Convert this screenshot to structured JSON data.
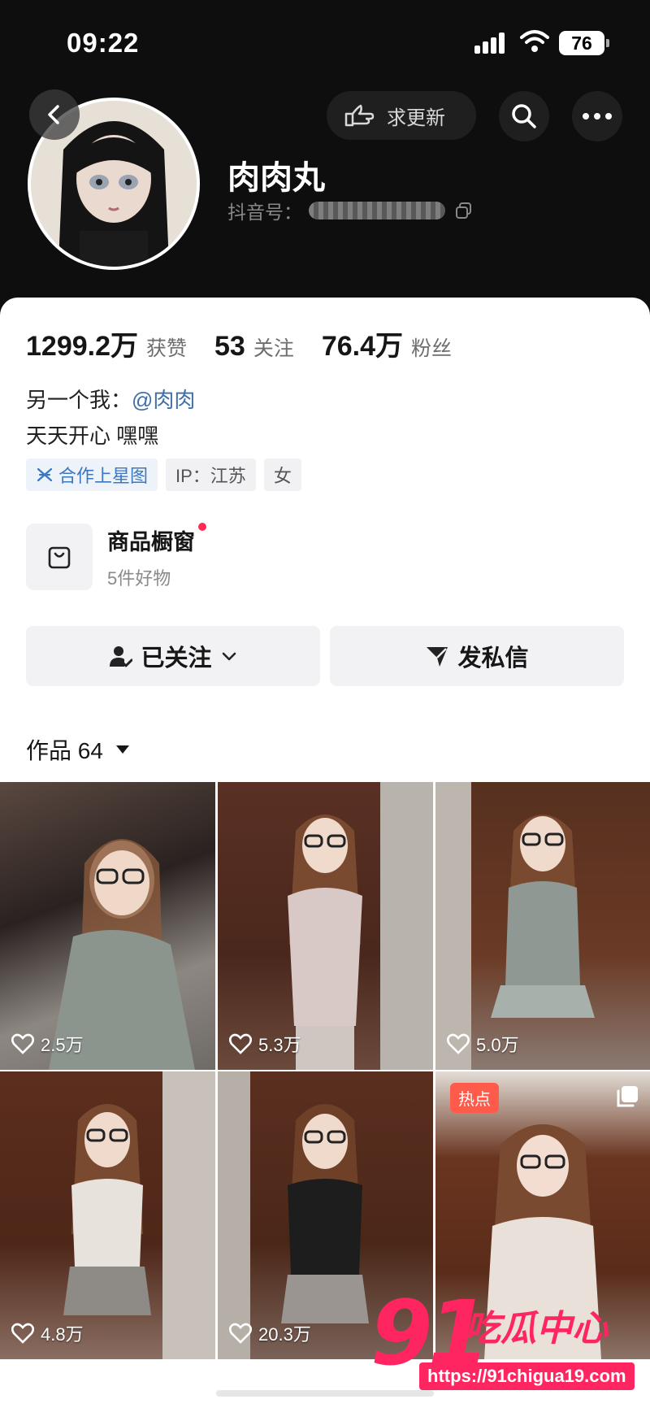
{
  "status_bar": {
    "time": "09:22",
    "battery": "76"
  },
  "top_actions": {
    "request_update_label": "求更新"
  },
  "profile": {
    "name": "肉肉丸",
    "id_label": "抖音号：",
    "stats": [
      {
        "num": "1299.2万",
        "label": "获赞"
      },
      {
        "num": "53",
        "label": "关注"
      },
      {
        "num": "76.4万",
        "label": "粉丝"
      }
    ],
    "bio_line1": "另一个我：",
    "bio_mention": "@肉肉",
    "bio_line2": "天天开心 嘿嘿",
    "tags": [
      "合作上星图",
      "IP：江苏",
      "女"
    ]
  },
  "shop": {
    "title": "商品橱窗",
    "subtitle": "5件好物"
  },
  "actions": {
    "follow_label": "已关注",
    "message_label": "发私信"
  },
  "works": {
    "label": "作品 64"
  },
  "videos": [
    {
      "likes": "2.5万"
    },
    {
      "likes": "5.3万"
    },
    {
      "likes": "5.0万"
    },
    {
      "likes": "4.8万"
    },
    {
      "likes": "20.3万"
    },
    {
      "likes": "",
      "badge": "热点"
    }
  ],
  "watermark": {
    "number": "91",
    "text": "吃瓜中心",
    "url": "https://91chigua19.com"
  },
  "colors": {
    "accent": "#fe2c55",
    "link": "#3d6ea8",
    "watermark": "#ff2560"
  }
}
